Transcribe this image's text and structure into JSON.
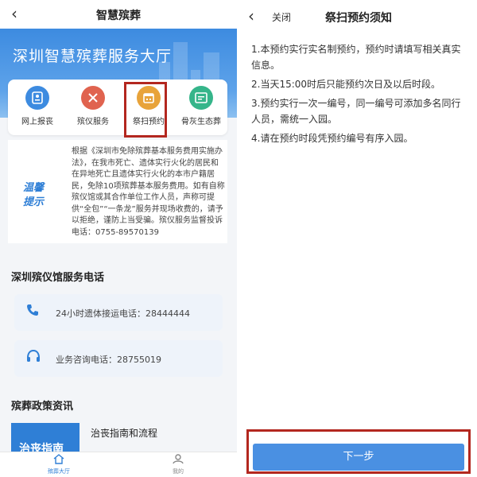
{
  "left": {
    "topbar": {
      "back_icon": "chevron-left-icon",
      "title": "智慧殡葬"
    },
    "banner": {
      "title": "深圳智慧殡葬服务大厅"
    },
    "services": [
      {
        "label": "网上报丧",
        "icon": "id-card-icon",
        "color": "#3d8be0"
      },
      {
        "label": "殡仪服务",
        "icon": "tools-icon",
        "color": "#e0634f"
      },
      {
        "label": "祭扫预约",
        "icon": "calendar-icon",
        "color": "#e8a33a"
      },
      {
        "label": "骨灰生态葬",
        "icon": "document-icon",
        "color": "#35b58a"
      }
    ],
    "notice": {
      "tag": "温馨提示",
      "text": "根据《深圳市免除殡葬基本服务费用实施办法》，在我市死亡、遗体实行火化的居民和在异地死亡且遗体实行火化的本市户籍居民，免除10项殡葬基本服务费用。如有自称殡仪馆或其合作单位工作人员，声称可提供“全包”“一条龙”服务并现场收费的，请予以拒绝，谨防上当受骗。殡仪服务监督投诉电话：0755-89570139"
    },
    "phone_section": {
      "title": "深圳殡仪馆服务电话",
      "items": [
        {
          "icon": "phone-icon",
          "text": "24小时遗体接运电话：28444444"
        },
        {
          "icon": "headset-icon",
          "text": "业务咨询电话：28755019"
        }
      ]
    },
    "news_section": {
      "title": "殡葬政策资讯",
      "thumb_text": "治丧指南",
      "item_title": "治丧指南和流程"
    },
    "tabbar": [
      {
        "label": "殡葬大厅",
        "icon": "home-icon"
      },
      {
        "label": "我的",
        "icon": "user-icon"
      }
    ]
  },
  "right": {
    "topbar": {
      "back_icon": "chevron-left-icon",
      "close_label": "关闭",
      "title": "祭扫预约须知"
    },
    "rules": [
      "1.本预约实行实名制预约，预约时请填写相关真实信息。",
      "2.当天15:00时后只能预约次日及以后时段。",
      "3.预约实行一次一编号，同一编号可添加多名同行人员，需统一入园。",
      "4.请在预约时段凭预约编号有序入园。"
    ],
    "next_button": "下一步"
  }
}
